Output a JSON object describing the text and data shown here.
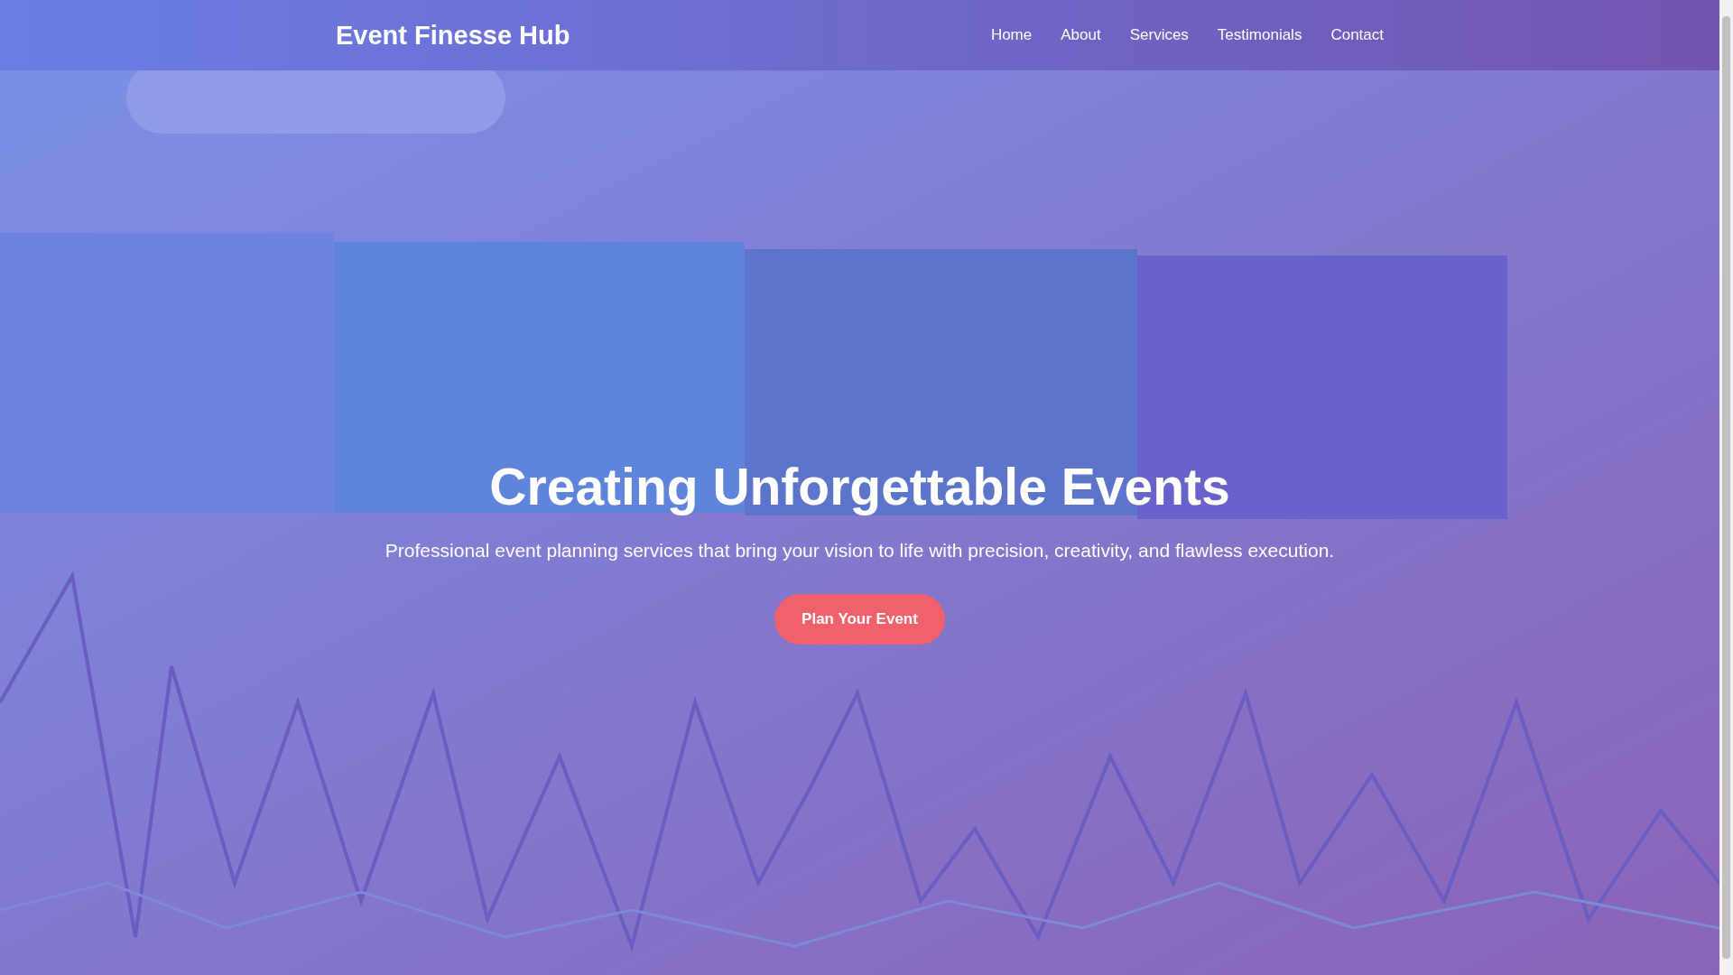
{
  "brand": "Event Finesse Hub",
  "nav": [
    {
      "label": "Home"
    },
    {
      "label": "About"
    },
    {
      "label": "Services"
    },
    {
      "label": "Testimonials"
    },
    {
      "label": "Contact"
    }
  ],
  "hero": {
    "title": "Creating Unforgettable Events",
    "subtitle": "Professional event planning services that bring your vision to life with precision, creativity, and flawless execution.",
    "button": "Plan Your Event"
  }
}
